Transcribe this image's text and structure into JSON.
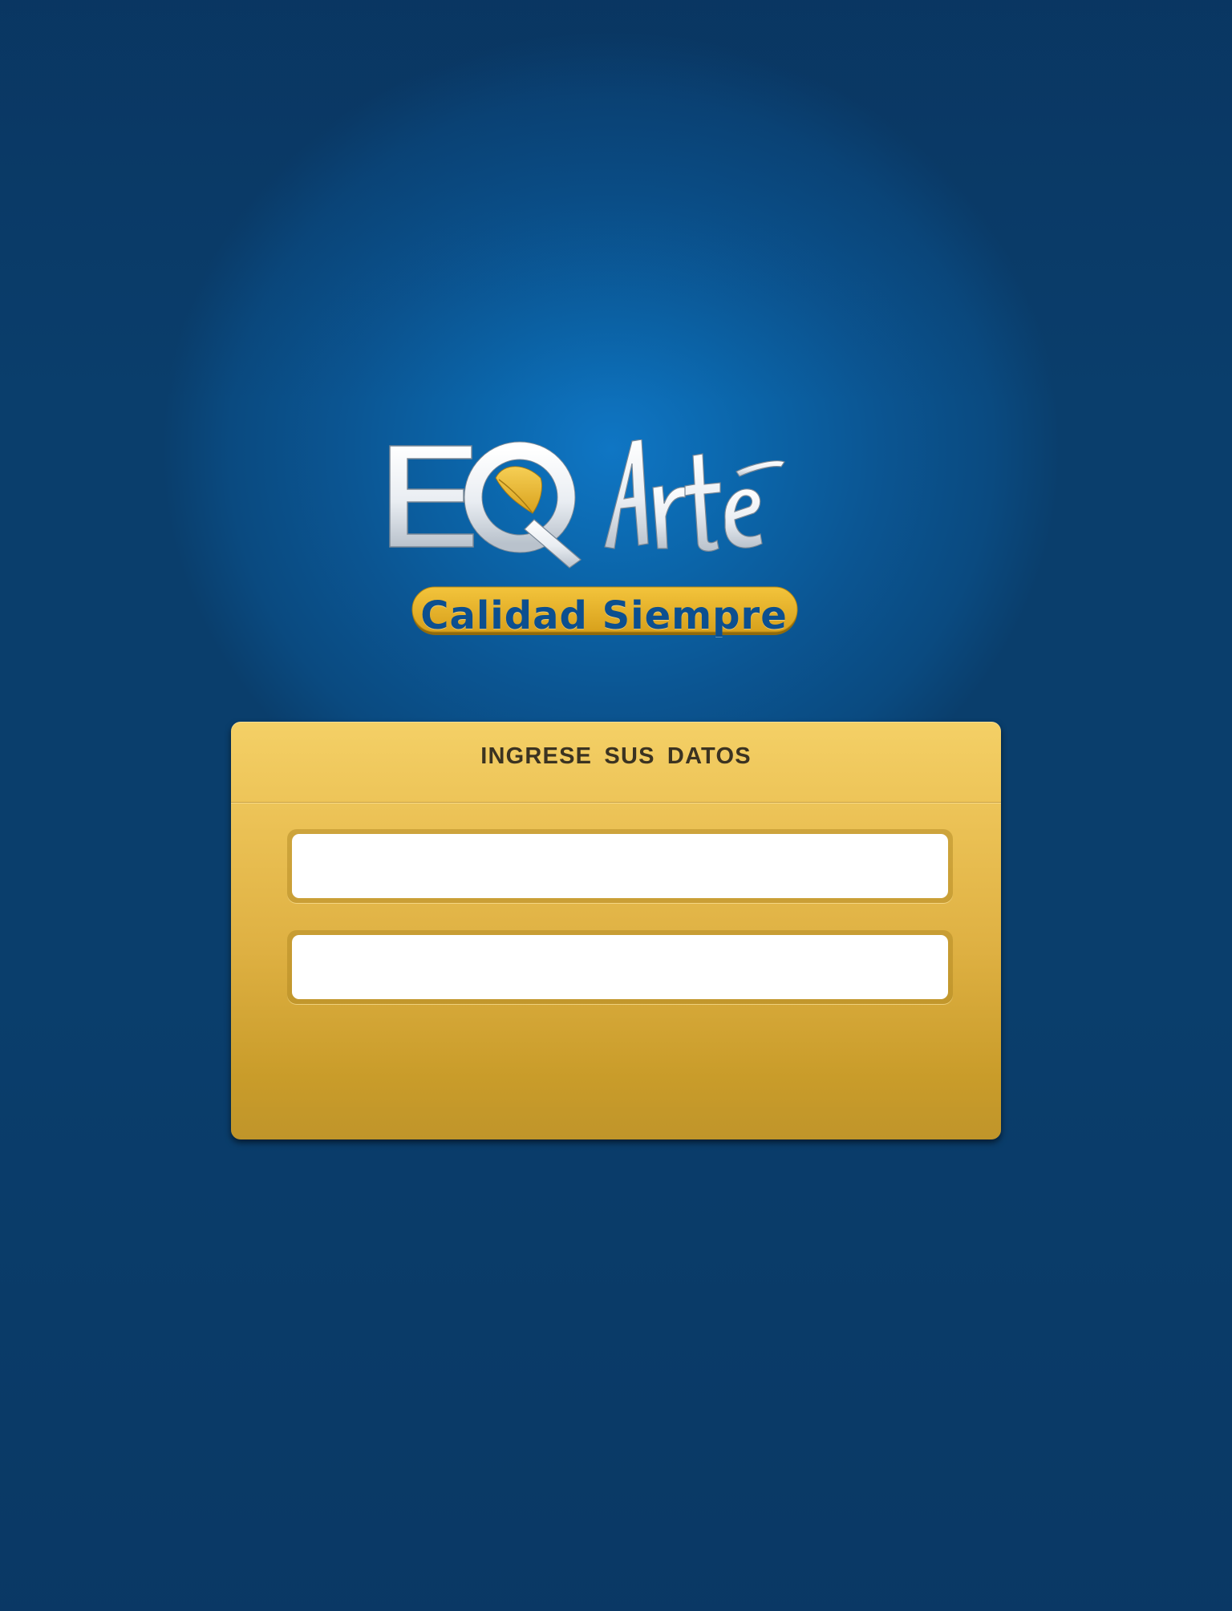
{
  "logo": {
    "wordmark_eq": "EQ",
    "wordmark_arte": "Arte",
    "tagline": "Calidad Siempre"
  },
  "login": {
    "title": "INGRESE SUS DATOS",
    "username": {
      "value": "",
      "placeholder": ""
    },
    "password": {
      "value": "",
      "placeholder": ""
    }
  },
  "colors": {
    "background": "#0b5592",
    "background_center": "#0f76c4",
    "card_top": "#f4d066",
    "card_bottom": "#c0952a",
    "title_text": "#3b3321",
    "tagline_text": "#0c4f8f",
    "accent_gold": "#e7b52c"
  }
}
